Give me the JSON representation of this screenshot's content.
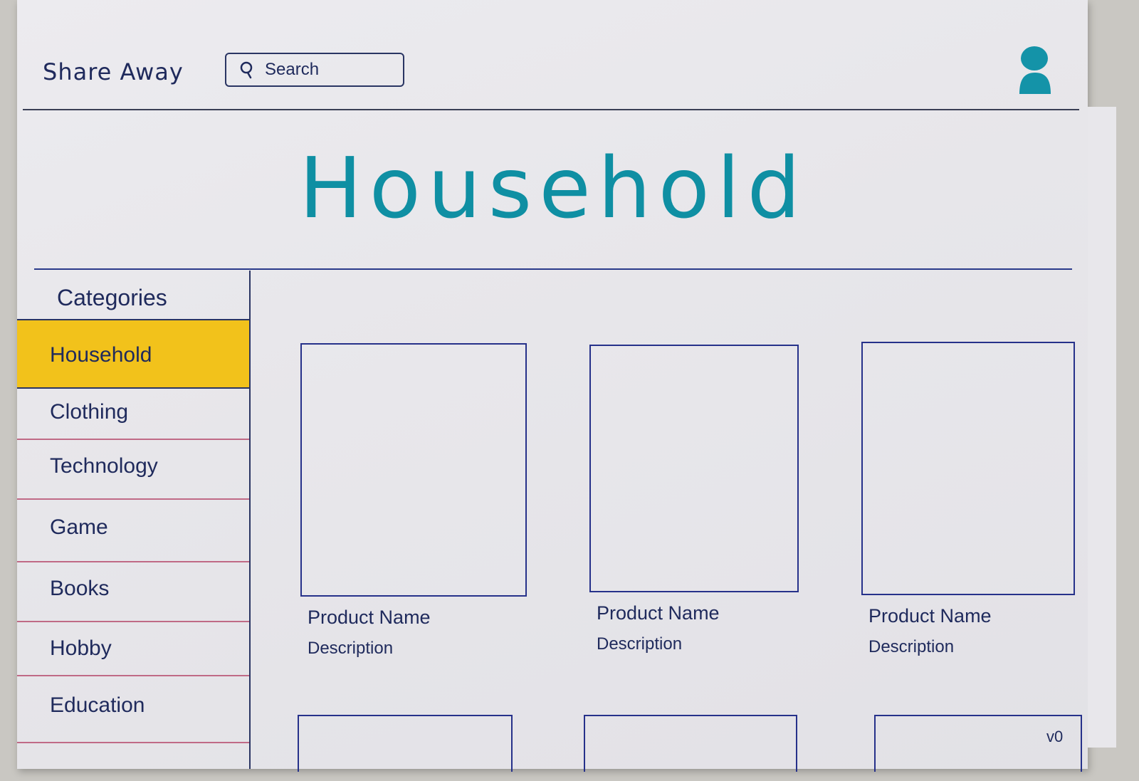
{
  "header": {
    "brand": "Share Away",
    "search": {
      "placeholder": "Search",
      "icon": "search-icon"
    },
    "avatar_icon": "user-avatar-icon"
  },
  "page": {
    "title": "Household"
  },
  "sidebar": {
    "heading": "Categories",
    "items": [
      {
        "label": "Household",
        "selected": true
      },
      {
        "label": "Clothing",
        "selected": false
      },
      {
        "label": "Technology",
        "selected": false
      },
      {
        "label": "Game",
        "selected": false
      },
      {
        "label": "Books",
        "selected": false
      },
      {
        "label": "Hobby",
        "selected": false
      },
      {
        "label": "Education",
        "selected": false
      }
    ]
  },
  "products": [
    {
      "name": "Product Name",
      "description": "Description"
    },
    {
      "name": "Product Name",
      "description": "Description"
    },
    {
      "name": "Product Name",
      "description": "Description"
    }
  ],
  "footer": {
    "version": "v0"
  },
  "colors": {
    "accent_title": "#0f8fa3",
    "selected_highlight": "#f2c21b",
    "ink": "#1f2a5c",
    "card_border": "#26318a",
    "avatar": "#1493a8"
  }
}
